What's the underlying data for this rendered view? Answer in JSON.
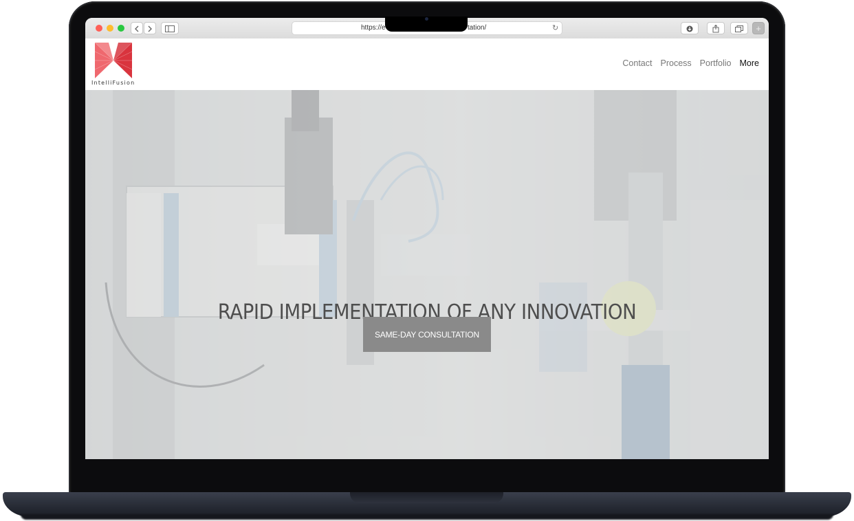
{
  "browser": {
    "url_visible_start": "https://e",
    "url_visible_end": "tation/",
    "reload_icon": "reload-icon",
    "back_icon": "chevron-left-icon",
    "forward_icon": "chevron-right-icon",
    "sidebar_icon": "sidebar-icon",
    "toolbar_icons": [
      "download-icon",
      "share-icon",
      "tabs-icon",
      "new-tab-icon"
    ]
  },
  "site": {
    "brand": "IntelliFusion",
    "nav": {
      "contact": "Contact",
      "process": "Process",
      "portfolio": "Portfolio",
      "more": "More"
    },
    "hero": {
      "title": "RAPID IMPLEMENTATION OF ANY INNOVATION",
      "cta": "SAME-DAY CONSULTATION"
    }
  },
  "colors": {
    "logo_red": "#e8414a",
    "cta_bg": "#8a8a8a",
    "laptop_body": "#262a34"
  }
}
